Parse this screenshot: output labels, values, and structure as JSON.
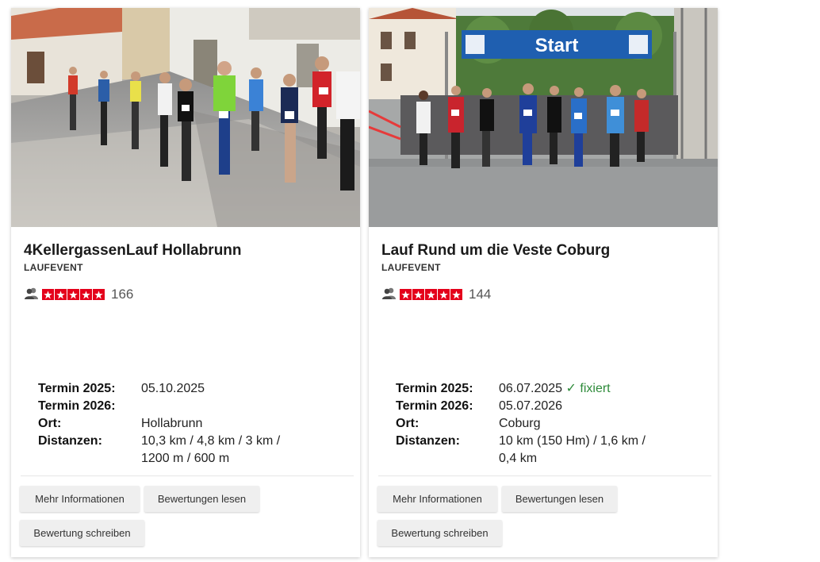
{
  "events": [
    {
      "title": "4KellergassenLauf Hollabrunn",
      "category": "LAUFEVENT",
      "rating_count": "166",
      "termin_2025_label": "Termin 2025:",
      "termin_2025_value": "05.10.2025",
      "termin_2025_status": "",
      "termin_2026_label": "Termin 2026:",
      "termin_2026_value": "",
      "ort_label": "Ort:",
      "ort_value": "Hollabrunn",
      "distanzen_label": "Distanzen:",
      "distanzen_value": "10,3 km / 4,8 km / 3 km / 1200 m / 600 m",
      "buttons": {
        "more": "Mehr Informationen",
        "read": "Bewertungen lesen",
        "write": "Bewertung schreiben"
      }
    },
    {
      "title": "Lauf Rund um die Veste Coburg",
      "category": "LAUFEVENT",
      "rating_count": "144",
      "termin_2025_label": "Termin 2025:",
      "termin_2025_value": "06.07.2025",
      "termin_2025_status": "✓ fixiert",
      "termin_2026_label": "Termin 2026:",
      "termin_2026_value": "05.07.2026",
      "ort_label": "Ort:",
      "ort_value": "Coburg",
      "distanzen_label": "Distanzen:",
      "distanzen_value": "10 km (150 Hm) / 1,6 km / 0,4 km",
      "buttons": {
        "more": "Mehr Informationen",
        "read": "Bewertungen lesen",
        "write": "Bewertung schreiben"
      },
      "banner_text": "Start"
    }
  ],
  "colors": {
    "star": "#e4001b",
    "fixed_status": "#2e8b3a",
    "banner": "#1f5fb0"
  }
}
